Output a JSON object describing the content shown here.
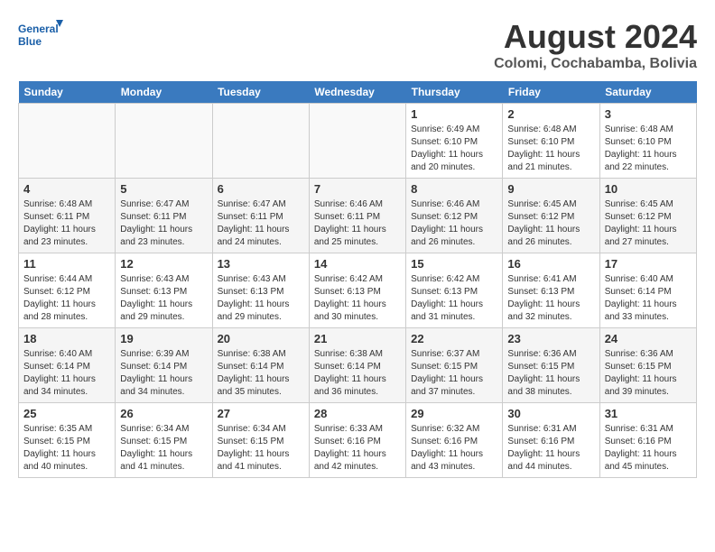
{
  "header": {
    "logo_text_top": "General",
    "logo_text_bottom": "Blue",
    "month_year": "August 2024",
    "location": "Colomi, Cochabamba, Bolivia"
  },
  "weekdays": [
    "Sunday",
    "Monday",
    "Tuesday",
    "Wednesday",
    "Thursday",
    "Friday",
    "Saturday"
  ],
  "weeks": [
    [
      {
        "day": "",
        "info": ""
      },
      {
        "day": "",
        "info": ""
      },
      {
        "day": "",
        "info": ""
      },
      {
        "day": "",
        "info": ""
      },
      {
        "day": "1",
        "info": "Sunrise: 6:49 AM\nSunset: 6:10 PM\nDaylight: 11 hours\nand 20 minutes."
      },
      {
        "day": "2",
        "info": "Sunrise: 6:48 AM\nSunset: 6:10 PM\nDaylight: 11 hours\nand 21 minutes."
      },
      {
        "day": "3",
        "info": "Sunrise: 6:48 AM\nSunset: 6:10 PM\nDaylight: 11 hours\nand 22 minutes."
      }
    ],
    [
      {
        "day": "4",
        "info": "Sunrise: 6:48 AM\nSunset: 6:11 PM\nDaylight: 11 hours\nand 23 minutes."
      },
      {
        "day": "5",
        "info": "Sunrise: 6:47 AM\nSunset: 6:11 PM\nDaylight: 11 hours\nand 23 minutes."
      },
      {
        "day": "6",
        "info": "Sunrise: 6:47 AM\nSunset: 6:11 PM\nDaylight: 11 hours\nand 24 minutes."
      },
      {
        "day": "7",
        "info": "Sunrise: 6:46 AM\nSunset: 6:11 PM\nDaylight: 11 hours\nand 25 minutes."
      },
      {
        "day": "8",
        "info": "Sunrise: 6:46 AM\nSunset: 6:12 PM\nDaylight: 11 hours\nand 26 minutes."
      },
      {
        "day": "9",
        "info": "Sunrise: 6:45 AM\nSunset: 6:12 PM\nDaylight: 11 hours\nand 26 minutes."
      },
      {
        "day": "10",
        "info": "Sunrise: 6:45 AM\nSunset: 6:12 PM\nDaylight: 11 hours\nand 27 minutes."
      }
    ],
    [
      {
        "day": "11",
        "info": "Sunrise: 6:44 AM\nSunset: 6:12 PM\nDaylight: 11 hours\nand 28 minutes."
      },
      {
        "day": "12",
        "info": "Sunrise: 6:43 AM\nSunset: 6:13 PM\nDaylight: 11 hours\nand 29 minutes."
      },
      {
        "day": "13",
        "info": "Sunrise: 6:43 AM\nSunset: 6:13 PM\nDaylight: 11 hours\nand 29 minutes."
      },
      {
        "day": "14",
        "info": "Sunrise: 6:42 AM\nSunset: 6:13 PM\nDaylight: 11 hours\nand 30 minutes."
      },
      {
        "day": "15",
        "info": "Sunrise: 6:42 AM\nSunset: 6:13 PM\nDaylight: 11 hours\nand 31 minutes."
      },
      {
        "day": "16",
        "info": "Sunrise: 6:41 AM\nSunset: 6:13 PM\nDaylight: 11 hours\nand 32 minutes."
      },
      {
        "day": "17",
        "info": "Sunrise: 6:40 AM\nSunset: 6:14 PM\nDaylight: 11 hours\nand 33 minutes."
      }
    ],
    [
      {
        "day": "18",
        "info": "Sunrise: 6:40 AM\nSunset: 6:14 PM\nDaylight: 11 hours\nand 34 minutes."
      },
      {
        "day": "19",
        "info": "Sunrise: 6:39 AM\nSunset: 6:14 PM\nDaylight: 11 hours\nand 34 minutes."
      },
      {
        "day": "20",
        "info": "Sunrise: 6:38 AM\nSunset: 6:14 PM\nDaylight: 11 hours\nand 35 minutes."
      },
      {
        "day": "21",
        "info": "Sunrise: 6:38 AM\nSunset: 6:14 PM\nDaylight: 11 hours\nand 36 minutes."
      },
      {
        "day": "22",
        "info": "Sunrise: 6:37 AM\nSunset: 6:15 PM\nDaylight: 11 hours\nand 37 minutes."
      },
      {
        "day": "23",
        "info": "Sunrise: 6:36 AM\nSunset: 6:15 PM\nDaylight: 11 hours\nand 38 minutes."
      },
      {
        "day": "24",
        "info": "Sunrise: 6:36 AM\nSunset: 6:15 PM\nDaylight: 11 hours\nand 39 minutes."
      }
    ],
    [
      {
        "day": "25",
        "info": "Sunrise: 6:35 AM\nSunset: 6:15 PM\nDaylight: 11 hours\nand 40 minutes."
      },
      {
        "day": "26",
        "info": "Sunrise: 6:34 AM\nSunset: 6:15 PM\nDaylight: 11 hours\nand 41 minutes."
      },
      {
        "day": "27",
        "info": "Sunrise: 6:34 AM\nSunset: 6:15 PM\nDaylight: 11 hours\nand 41 minutes."
      },
      {
        "day": "28",
        "info": "Sunrise: 6:33 AM\nSunset: 6:16 PM\nDaylight: 11 hours\nand 42 minutes."
      },
      {
        "day": "29",
        "info": "Sunrise: 6:32 AM\nSunset: 6:16 PM\nDaylight: 11 hours\nand 43 minutes."
      },
      {
        "day": "30",
        "info": "Sunrise: 6:31 AM\nSunset: 6:16 PM\nDaylight: 11 hours\nand 44 minutes."
      },
      {
        "day": "31",
        "info": "Sunrise: 6:31 AM\nSunset: 6:16 PM\nDaylight: 11 hours\nand 45 minutes."
      }
    ]
  ]
}
